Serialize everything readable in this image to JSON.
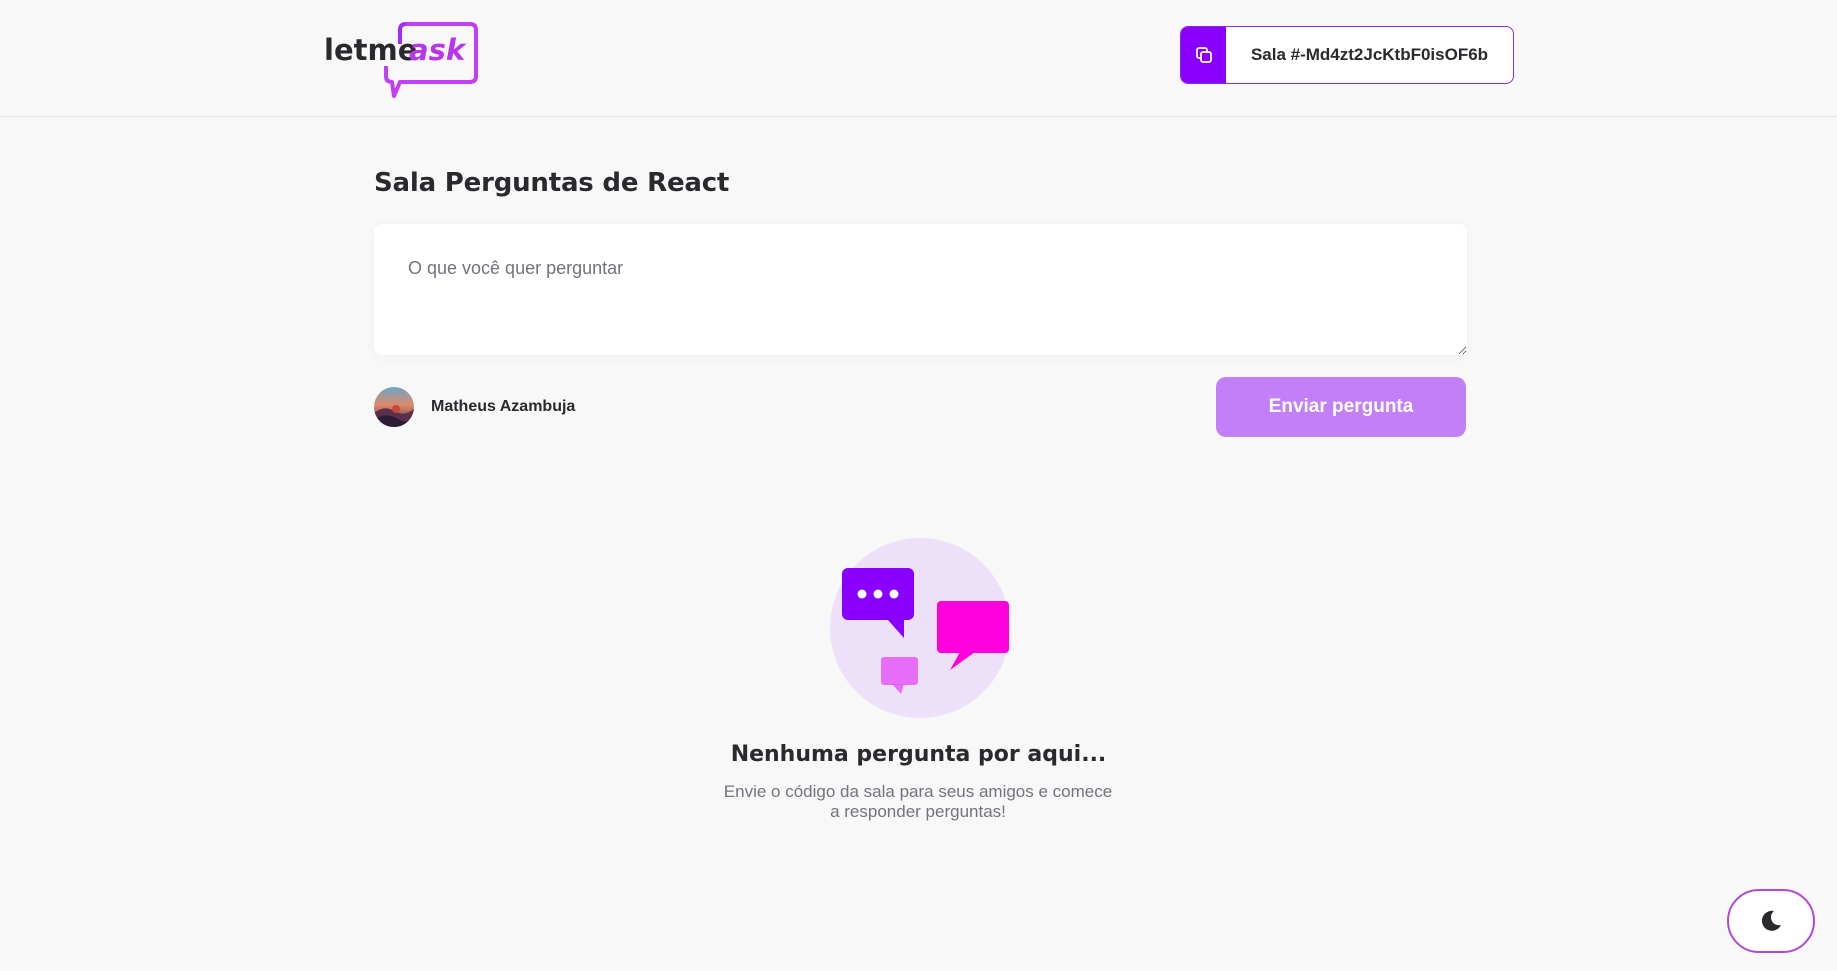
{
  "header": {
    "logo": {
      "part1": "letme",
      "part2": "ask"
    },
    "room_code": {
      "label": "Sala #-Md4zt2JcKtbF0isOF6b",
      "icon": "copy-icon"
    }
  },
  "main": {
    "title": "Sala Perguntas de React",
    "question_input": {
      "placeholder": "O que você quer perguntar",
      "value": ""
    },
    "user": {
      "name": "Matheus Azambuja"
    },
    "send_button_label": "Enviar pergunta"
  },
  "empty_state": {
    "title": "Nenhuma pergunta por aqui...",
    "description_line1": "Envie o código da sala para seus amigos e comece",
    "description_line2": "a responder perguntas!"
  },
  "theme_toggle": {
    "icon": "moon-icon"
  },
  "colors": {
    "brand_purple": "#8a00ff",
    "brand_pink": "#e559f9",
    "button_disabled": "#c27ff7",
    "background": "#f8f8f8",
    "text_primary": "#29292e",
    "text_muted": "#737380"
  }
}
